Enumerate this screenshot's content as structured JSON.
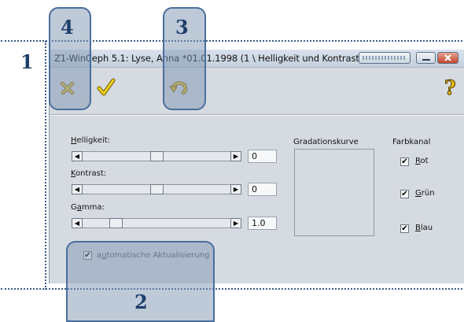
{
  "callouts": {
    "c1": "1",
    "c2": "2",
    "c3": "3",
    "c4": "4"
  },
  "window": {
    "title": "Z1-WinCeph 5.1: Lyse, Anna *01.01.1998 (1 \\ Helligkeit und Kontrast",
    "title_controls": [
      "progress-indicator",
      "minimize-icon",
      "close-icon"
    ]
  },
  "toolbar": {
    "icons": [
      "cancel-x-icon",
      "ok-check-icon",
      "undo-icon",
      "help-question-icon"
    ]
  },
  "sliders": [
    {
      "label_underlined": "H",
      "label_rest": "elligkeit:",
      "value": "0",
      "level": 0.5
    },
    {
      "label_underlined": "K",
      "label_rest": "ontrast:",
      "value": "0",
      "level": 0.5
    },
    {
      "label_pre": "G",
      "label_underlined": "a",
      "label_rest": "mma:",
      "value": "1.0",
      "level": 0.2
    }
  ],
  "gradation": {
    "label": "Gradationskurve"
  },
  "channels": {
    "label": "Farbkanal",
    "items": [
      {
        "underlined": "R",
        "rest": "ot",
        "checked": true
      },
      {
        "underlined": "G",
        "rest": "rün",
        "checked": true
      },
      {
        "underlined": "B",
        "rest": "lau",
        "checked": true
      }
    ]
  },
  "auto_update": {
    "pre": "a",
    "underlined": "u",
    "rest": "tomatische Aktualisierung",
    "checked": true
  }
}
